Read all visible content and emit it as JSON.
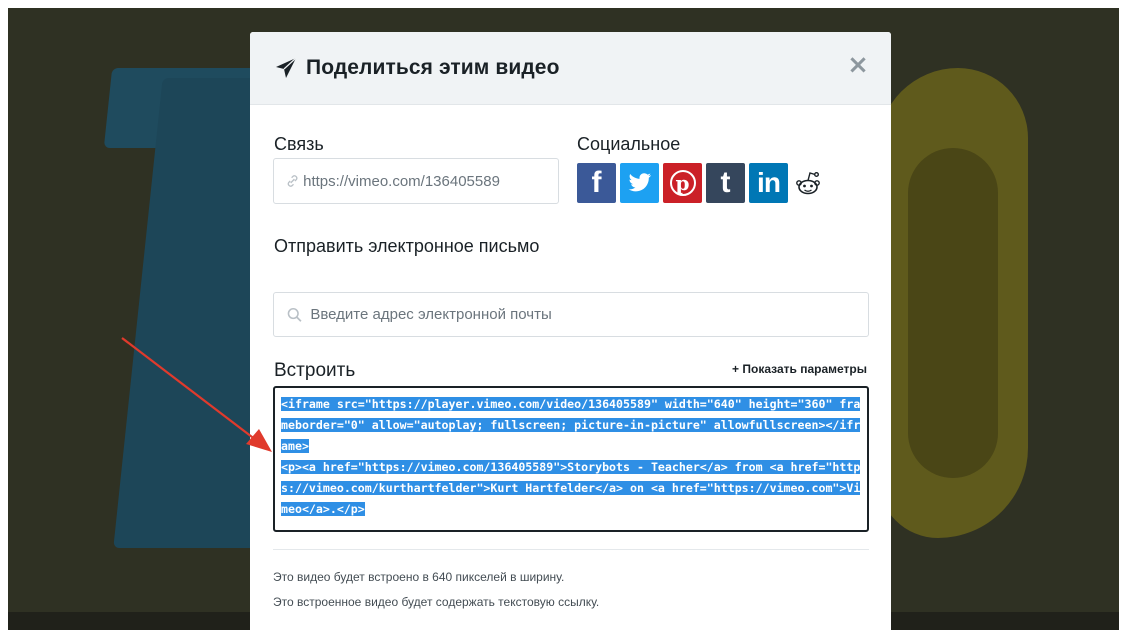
{
  "modal": {
    "title": "Поделиться этим видео",
    "close_symbol": "×",
    "icons": {
      "title": "paper-plane-icon",
      "close": "close-icon"
    }
  },
  "link": {
    "label": "Связь",
    "value": "https://vimeo.com/136405589",
    "icon": "link-icon"
  },
  "social": {
    "label": "Социальное",
    "items": [
      {
        "name": "facebook",
        "glyph": "f",
        "color": "#3b5998"
      },
      {
        "name": "twitter",
        "glyph": "twitter-bird",
        "color": "#1da1f2"
      },
      {
        "name": "pinterest",
        "glyph": "p",
        "color": "#cb2027"
      },
      {
        "name": "tumblr",
        "glyph": "t",
        "color": "#35465c"
      },
      {
        "name": "linkedin",
        "glyph": "in",
        "color": "#0077b5"
      },
      {
        "name": "reddit",
        "glyph": "reddit-alien",
        "color": "#1a2126"
      }
    ]
  },
  "email": {
    "label": "Отправить электронное письмо",
    "placeholder": "Введите адрес электронной почты",
    "icon": "search-icon"
  },
  "embed": {
    "label": "Встроить",
    "show_params": "+ Показать параметры",
    "code": "<iframe src=\"https://player.vimeo.com/video/136405589\" width=\"640\" height=\"360\" frameborder=\"0\" allow=\"autoplay; fullscreen; picture-in-picture\" allowfullscreen></iframe>\n<p><a href=\"https://vimeo.com/136405589\">Storybots - Teacher</a> from <a href=\"https://vimeo.com/kurthartfelder\">Kurt Hartfelder</a> on <a href=\"https://vimeo.com\">Vimeo</a>.</p>",
    "selection_color": "#2f8fe5"
  },
  "notes": {
    "width_note": "Это видео будет встроено в 640 пикселей в ширину.",
    "link_note": "Это встроенное видео будет содержать текстовую ссылку."
  },
  "colors": {
    "annotation_arrow": "#e03a2c",
    "backdrop": "#2f3123"
  }
}
